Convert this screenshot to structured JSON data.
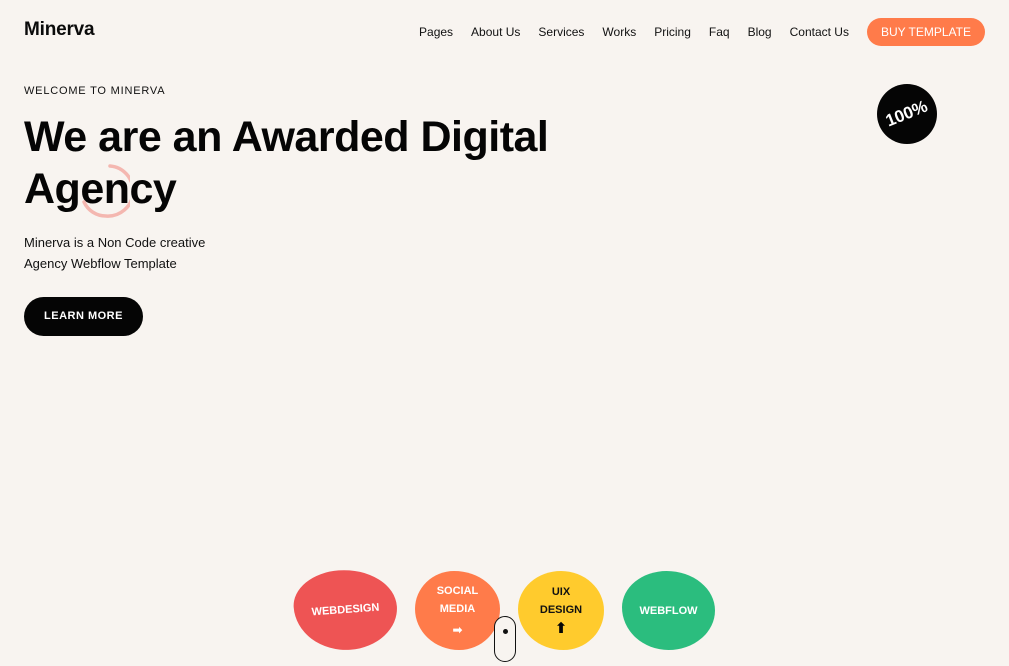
{
  "header": {
    "logo": "Minerva",
    "nav": [
      "Pages",
      "About Us",
      "Services",
      "Works",
      "Pricing",
      "Faq",
      "Blog",
      "Contact Us"
    ],
    "cta_label": "BUY TEMPLATE"
  },
  "hero": {
    "eyebrow": "WELCOME TO MINERVA",
    "title_line1": "We are an Awarded Digital",
    "title_line2": "Agency",
    "desc_line1": "Minerva is a Non Code creative",
    "desc_line2": "Agency Webflow Template",
    "button_label": "LEARN MORE"
  },
  "badge": {
    "text": "100%"
  },
  "blobs": {
    "webdesign": "WEBDESIGN",
    "social_line1": "SOCIAL",
    "social_line2": "MEDIA",
    "uix_line1": "UIX",
    "uix_line2": "DESIGN",
    "webflow": "WEBFLOW"
  },
  "colors": {
    "background": "#f8f4f0",
    "accent_orange": "#ff7b4a",
    "red": "#ee5454",
    "yellow": "#ffcb2d",
    "green": "#2bbd7e",
    "dark": "#050505"
  },
  "icons": {
    "spinner": "loading-spinner-icon",
    "social_arrow": "arrow-right-icon",
    "uix_arrow": "arrow-up-icon",
    "scroll": "scroll-mouse-icon"
  }
}
